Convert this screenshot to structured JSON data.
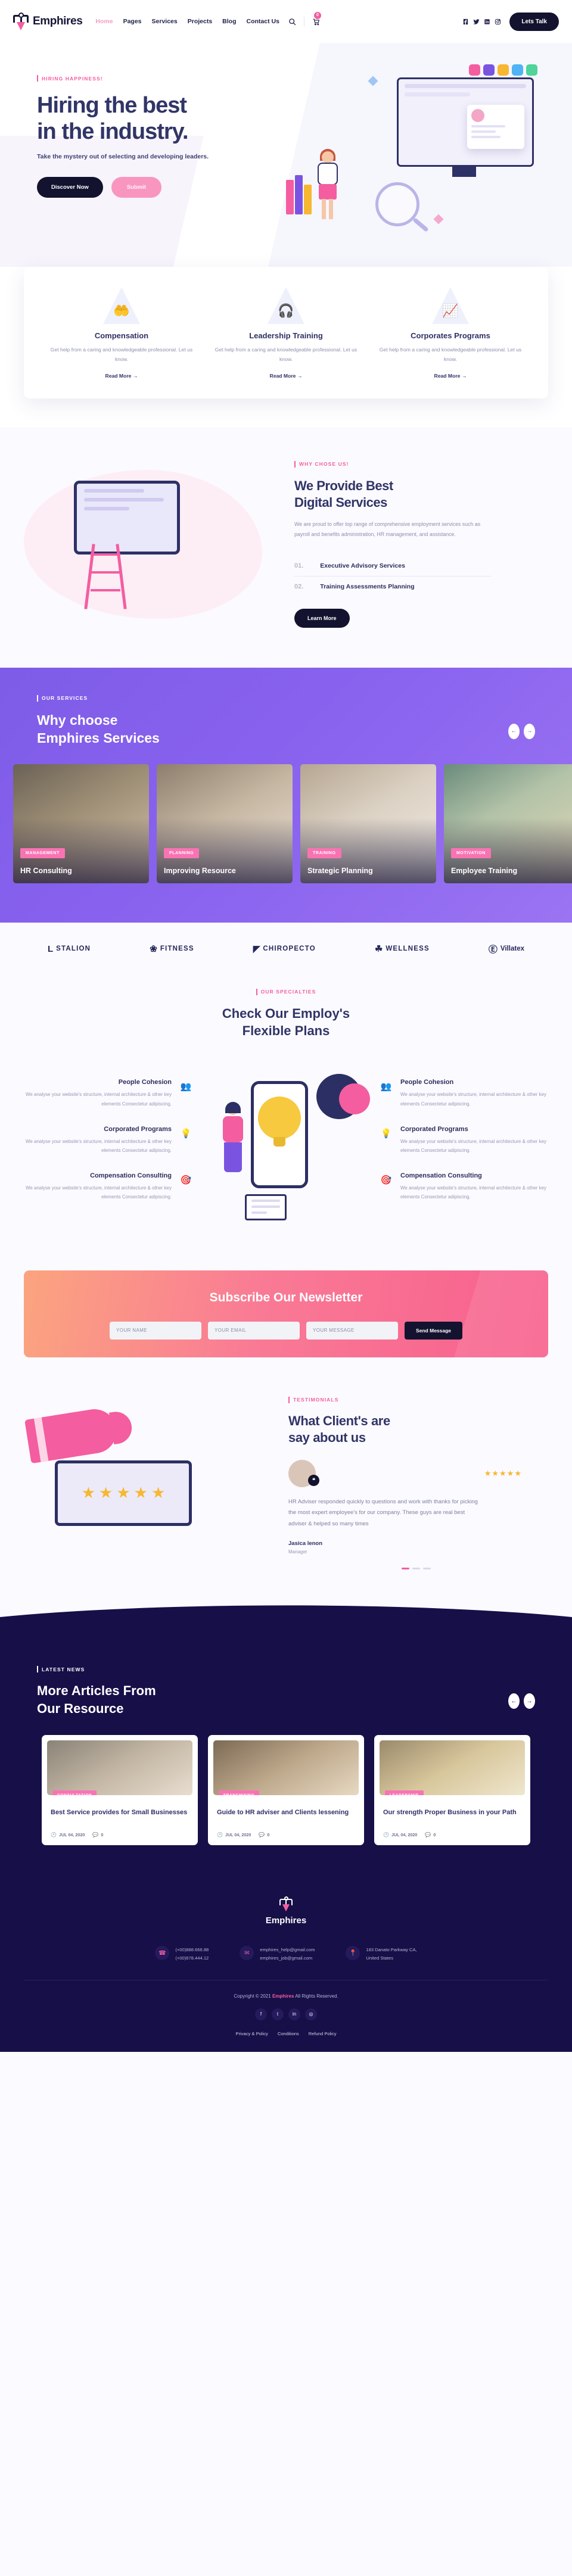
{
  "brand": {
    "name": "Emphires",
    "logo_icon": "location-pin-logo"
  },
  "nav": {
    "links": [
      {
        "label": "Home",
        "active": true
      },
      {
        "label": "Pages",
        "active": false
      },
      {
        "label": "Services",
        "active": false
      },
      {
        "label": "Projects",
        "active": false
      },
      {
        "label": "Blog",
        "active": false
      },
      {
        "label": "Contact Us",
        "active": false
      }
    ],
    "search_icon": "search-icon",
    "cart_icon": "cart-icon",
    "cart_count": "0",
    "socials": [
      "facebook-icon",
      "twitter-icon",
      "linkedin-icon",
      "instagram-icon"
    ],
    "cta": "Lets Talk"
  },
  "hero": {
    "eyebrow": "HIRING HAPPINESS!",
    "title_line1": "Hiring the best",
    "title_line2": "in the industry.",
    "subtitle": "Take the mystery out of selecting and developing leaders.",
    "btn_primary": "Discover Now",
    "btn_secondary": "Submit"
  },
  "services_cards": [
    {
      "icon": "caring-hands-icon",
      "glyph": "🤲",
      "title": "Compensation",
      "text": "Get help from a caring and knowledgeable professional. Let us know.",
      "link": "Read More"
    },
    {
      "icon": "headset-agent-icon",
      "glyph": "🎧",
      "title": "Leadership Training",
      "text": "Get help from a caring and knowledgeable professional. Let us know.",
      "link": "Read More"
    },
    {
      "icon": "growth-chart-icon",
      "glyph": "📈",
      "title": "Corporates Programs",
      "text": "Get help from a caring and knowledgeable professional. Let us know.",
      "link": "Read More"
    }
  ],
  "digital": {
    "eyebrow": "WHY CHOSE US!",
    "title_line1": "We Provide Best",
    "title_line2": "Digital Services",
    "lead": "We are proud to offer top range of comprehensive employment services such as payroll and benefits administration, HR management, and assistance.",
    "items": [
      {
        "num": "01.",
        "name": "Executive Advisory Services"
      },
      {
        "num": "02.",
        "name": "Training Assessments Planning"
      }
    ],
    "button": "Learn More"
  },
  "why": {
    "eyebrow": "OUR SERVICES",
    "title_line1": "Why choose",
    "title_line2": "Emphires Services",
    "prev_icon": "arrow-left-icon",
    "next_icon": "arrow-right-icon",
    "tiles": [
      {
        "tag": "MANAGEMENT",
        "title": "HR Consulting"
      },
      {
        "tag": "PLANNING",
        "title": "Improving Resource"
      },
      {
        "tag": "TRAINING",
        "title": "Strategic Planning"
      },
      {
        "tag": "MOTIVATION",
        "title": "Employee Training"
      }
    ]
  },
  "logos": [
    {
      "glyph": "L",
      "text": "STALION"
    },
    {
      "glyph": "❀",
      "text": "FITNESS"
    },
    {
      "glyph": "◤",
      "text": "CHIROPECTO"
    },
    {
      "glyph": "☘",
      "text": "WELLNESS"
    },
    {
      "glyph": "Ⓔ",
      "text": "Villatex"
    }
  ],
  "plans": {
    "eyebrow": "OUR SPECIALTIES",
    "title_line1": "Check Our Employ's",
    "title_line2": "Flexible Plans",
    "left": [
      {
        "icon": "people-chat-icon",
        "glyph": "👥",
        "title": "People Cohesion",
        "text": "We analyse your website's structure, internal architecture & other key elements Consectetur adipiscing."
      },
      {
        "icon": "team-idea-icon",
        "glyph": "💡",
        "title": "Corporated Programs",
        "text": "We analyse your website's structure, internal architecture & other key elements Consectetur adipiscing."
      },
      {
        "icon": "target-chart-icon",
        "glyph": "🎯",
        "title": "Compensation Consulting",
        "text": "We analyse your website's structure, internal architecture & other key elements Consectetur adipiscing."
      }
    ],
    "right": [
      {
        "icon": "people-chat-icon",
        "glyph": "👥",
        "title": "People Cohesion",
        "text": "We analyse your website's structure, internal architecture & other key elements Consectetur adipiscing."
      },
      {
        "icon": "team-idea-icon",
        "glyph": "💡",
        "title": "Corporated Programs",
        "text": "We analyse your website's structure, internal architecture & other key elements Consectetur adipiscing."
      },
      {
        "icon": "target-chart-icon",
        "glyph": "🎯",
        "title": "Compensation Consulting",
        "text": "We analyse your website's structure, internal architecture & other key elements Consectetur adipiscing."
      }
    ]
  },
  "newsletter": {
    "title": "Subscribe Our Newsletter",
    "name_placeholder": "YOUR NAME",
    "email_placeholder": "YOUR EMAIL",
    "message_placeholder": "YOUR MESSAGE",
    "button": "Send Message"
  },
  "testimonials": {
    "eyebrow": "TESTIMONIALS",
    "title_line1": "What Client's are",
    "title_line2": "say about us",
    "quote_icon": "quote-icon",
    "stars": "★★★★★",
    "body": "HR Adviser responded quickly to questions and work with thanks for picking the most expert employee's for our company. These guys are real best adviser &  helped so many times",
    "author": "Jasica lenon",
    "role": "Manager"
  },
  "blog": {
    "eyebrow": "LATEST NEWS",
    "title_line1": "More Articles From",
    "title_line2": "Our Resource",
    "prev_icon": "arrow-left-icon",
    "next_icon": "arrow-right-icon",
    "posts": [
      {
        "tag": "CONSULTATION",
        "title": "Best Service provides for Small Businesses",
        "date": "JUL 04, 2020",
        "comments": "0"
      },
      {
        "tag": "FRANCHISING",
        "title": "Guide to HR adviser and Clients lessening",
        "date": "JUL 04, 2020",
        "comments": "0"
      },
      {
        "tag": "LEADERSHIP",
        "title": "Our strength Proper Business in your Path",
        "date": "JUL 04, 2020",
        "comments": "0"
      }
    ]
  },
  "footer": {
    "brand": "Emphires",
    "contacts": [
      {
        "icon": "phone-icon",
        "glyph": "☎",
        "line1": "(+00)888.666.88",
        "line2": "(+00)678.444.12"
      },
      {
        "icon": "mail-icon",
        "glyph": "✉",
        "line1": "emphires_help@gmail.com",
        "line2": "emphires_job@gmail.com"
      },
      {
        "icon": "map-pin-icon",
        "glyph": "📍",
        "line1": "183 Danato Parkway CA,",
        "line2": "United States"
      }
    ],
    "copyright_pre": "Copyright © 2021 ",
    "copyright_brand": "Emphires",
    "copyright_post": " All Rights Reserved.",
    "socials": [
      "facebook-icon",
      "twitter-icon",
      "linkedin-icon",
      "instagram-icon"
    ],
    "links": [
      "Privacy & Policy",
      "Conditions",
      "Refund Policy"
    ]
  }
}
